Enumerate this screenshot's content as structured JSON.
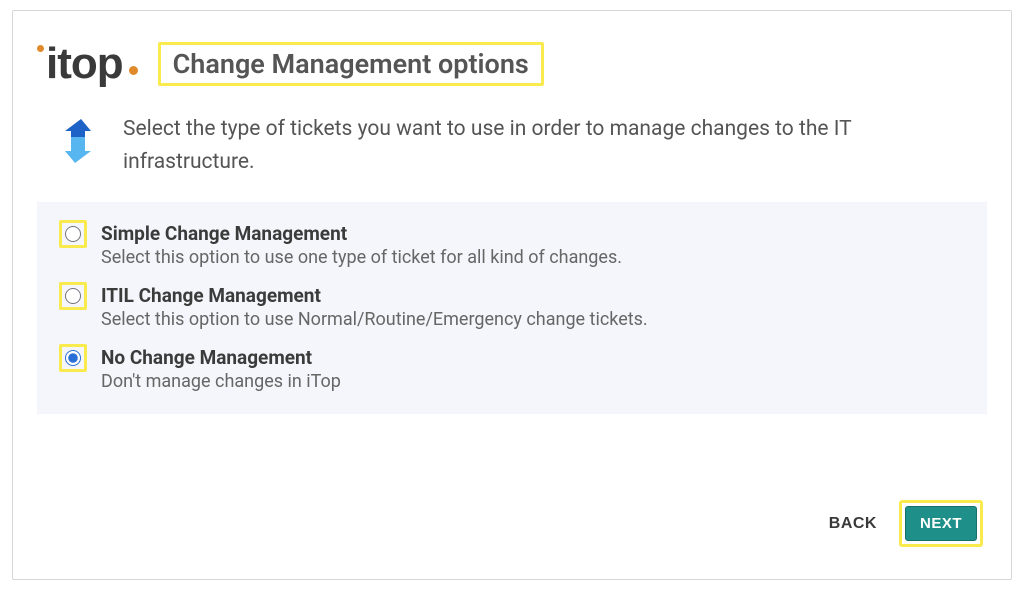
{
  "logo_text": "itop",
  "title": "Change Management options",
  "intro": "Select the type of tickets you want to use in order to manage changes to the IT infrastructure.",
  "options": [
    {
      "title": "Simple Change Management",
      "desc": "Select this option to use one type of ticket for all kind of changes.",
      "selected": false
    },
    {
      "title": "ITIL Change Management",
      "desc": "Select this option to use Normal/Routine/Emergency change tickets.",
      "selected": false
    },
    {
      "title": "No Change Management",
      "desc": "Don't manage changes in iTop",
      "selected": true
    }
  ],
  "buttons": {
    "back": "BACK",
    "next": "NEXT"
  },
  "colors": {
    "accent_teal": "#1f8f8a",
    "highlight": "#f9ea4d",
    "logo_orange": "#e08a2c"
  }
}
